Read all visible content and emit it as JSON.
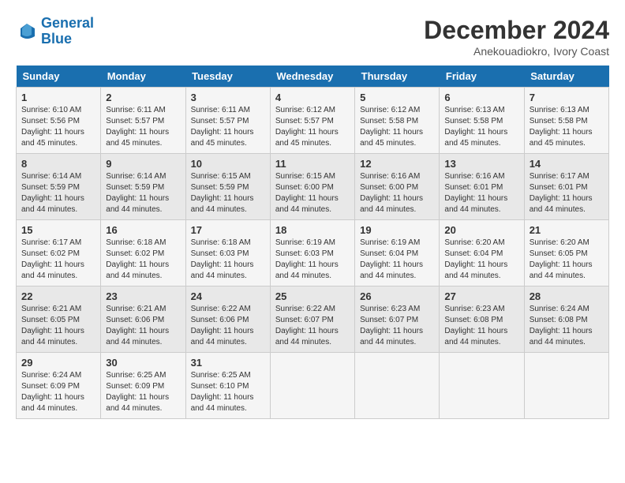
{
  "logo": {
    "line1": "General",
    "line2": "Blue"
  },
  "title": "December 2024",
  "location": "Anekouadiokro, Ivory Coast",
  "days_of_week": [
    "Sunday",
    "Monday",
    "Tuesday",
    "Wednesday",
    "Thursday",
    "Friday",
    "Saturday"
  ],
  "weeks": [
    [
      {
        "day": "1",
        "sunrise": "6:10 AM",
        "sunset": "5:56 PM",
        "daylight": "11 hours and 45 minutes."
      },
      {
        "day": "2",
        "sunrise": "6:11 AM",
        "sunset": "5:57 PM",
        "daylight": "11 hours and 45 minutes."
      },
      {
        "day": "3",
        "sunrise": "6:11 AM",
        "sunset": "5:57 PM",
        "daylight": "11 hours and 45 minutes."
      },
      {
        "day": "4",
        "sunrise": "6:12 AM",
        "sunset": "5:57 PM",
        "daylight": "11 hours and 45 minutes."
      },
      {
        "day": "5",
        "sunrise": "6:12 AM",
        "sunset": "5:58 PM",
        "daylight": "11 hours and 45 minutes."
      },
      {
        "day": "6",
        "sunrise": "6:13 AM",
        "sunset": "5:58 PM",
        "daylight": "11 hours and 45 minutes."
      },
      {
        "day": "7",
        "sunrise": "6:13 AM",
        "sunset": "5:58 PM",
        "daylight": "11 hours and 45 minutes."
      }
    ],
    [
      {
        "day": "8",
        "sunrise": "6:14 AM",
        "sunset": "5:59 PM",
        "daylight": "11 hours and 44 minutes."
      },
      {
        "day": "9",
        "sunrise": "6:14 AM",
        "sunset": "5:59 PM",
        "daylight": "11 hours and 44 minutes."
      },
      {
        "day": "10",
        "sunrise": "6:15 AM",
        "sunset": "5:59 PM",
        "daylight": "11 hours and 44 minutes."
      },
      {
        "day": "11",
        "sunrise": "6:15 AM",
        "sunset": "6:00 PM",
        "daylight": "11 hours and 44 minutes."
      },
      {
        "day": "12",
        "sunrise": "6:16 AM",
        "sunset": "6:00 PM",
        "daylight": "11 hours and 44 minutes."
      },
      {
        "day": "13",
        "sunrise": "6:16 AM",
        "sunset": "6:01 PM",
        "daylight": "11 hours and 44 minutes."
      },
      {
        "day": "14",
        "sunrise": "6:17 AM",
        "sunset": "6:01 PM",
        "daylight": "11 hours and 44 minutes."
      }
    ],
    [
      {
        "day": "15",
        "sunrise": "6:17 AM",
        "sunset": "6:02 PM",
        "daylight": "11 hours and 44 minutes."
      },
      {
        "day": "16",
        "sunrise": "6:18 AM",
        "sunset": "6:02 PM",
        "daylight": "11 hours and 44 minutes."
      },
      {
        "day": "17",
        "sunrise": "6:18 AM",
        "sunset": "6:03 PM",
        "daylight": "11 hours and 44 minutes."
      },
      {
        "day": "18",
        "sunrise": "6:19 AM",
        "sunset": "6:03 PM",
        "daylight": "11 hours and 44 minutes."
      },
      {
        "day": "19",
        "sunrise": "6:19 AM",
        "sunset": "6:04 PM",
        "daylight": "11 hours and 44 minutes."
      },
      {
        "day": "20",
        "sunrise": "6:20 AM",
        "sunset": "6:04 PM",
        "daylight": "11 hours and 44 minutes."
      },
      {
        "day": "21",
        "sunrise": "6:20 AM",
        "sunset": "6:05 PM",
        "daylight": "11 hours and 44 minutes."
      }
    ],
    [
      {
        "day": "22",
        "sunrise": "6:21 AM",
        "sunset": "6:05 PM",
        "daylight": "11 hours and 44 minutes."
      },
      {
        "day": "23",
        "sunrise": "6:21 AM",
        "sunset": "6:06 PM",
        "daylight": "11 hours and 44 minutes."
      },
      {
        "day": "24",
        "sunrise": "6:22 AM",
        "sunset": "6:06 PM",
        "daylight": "11 hours and 44 minutes."
      },
      {
        "day": "25",
        "sunrise": "6:22 AM",
        "sunset": "6:07 PM",
        "daylight": "11 hours and 44 minutes."
      },
      {
        "day": "26",
        "sunrise": "6:23 AM",
        "sunset": "6:07 PM",
        "daylight": "11 hours and 44 minutes."
      },
      {
        "day": "27",
        "sunrise": "6:23 AM",
        "sunset": "6:08 PM",
        "daylight": "11 hours and 44 minutes."
      },
      {
        "day": "28",
        "sunrise": "6:24 AM",
        "sunset": "6:08 PM",
        "daylight": "11 hours and 44 minutes."
      }
    ],
    [
      {
        "day": "29",
        "sunrise": "6:24 AM",
        "sunset": "6:09 PM",
        "daylight": "11 hours and 44 minutes."
      },
      {
        "day": "30",
        "sunrise": "6:25 AM",
        "sunset": "6:09 PM",
        "daylight": "11 hours and 44 minutes."
      },
      {
        "day": "31",
        "sunrise": "6:25 AM",
        "sunset": "6:10 PM",
        "daylight": "11 hours and 44 minutes."
      },
      null,
      null,
      null,
      null
    ]
  ]
}
